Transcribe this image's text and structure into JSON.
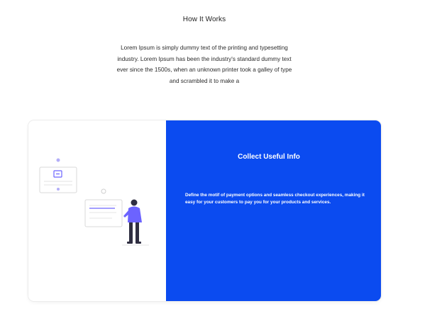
{
  "header": {
    "title": "How It Works",
    "intro": "Lorem Ipsum is simply dummy text of the printing and typesetting industry. Lorem Ipsum has been the industry's standard dummy text ever since the 1500s, when an unknown printer took a galley of type and scrambled it to make a"
  },
  "card": {
    "title": "Collect Useful Info",
    "body": "Define the motif of payment options and seamless checkout experiences, making it easy for your customers to pay you for your products and services.",
    "illustration_icon": "person-with-forms-illustration",
    "colors": {
      "panel": "#0b4bf0",
      "accent": "#6c63ff",
      "figure_dark": "#2f2e41"
    }
  }
}
